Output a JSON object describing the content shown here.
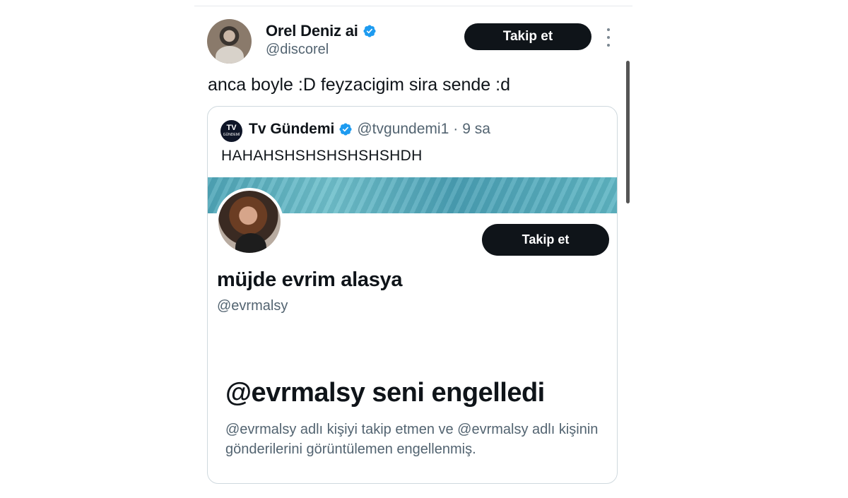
{
  "author": {
    "display_name": "Orel Deniz ai",
    "handle": "@discorel",
    "follow_label": "Takip et"
  },
  "tweet": {
    "text": "anca boyle :D feyzacigim sira sende :d"
  },
  "quoted": {
    "avatar_text": "TV",
    "avatar_subtext": "GÜNDEMİ",
    "display_name": "Tv Gündemi",
    "handle": "@tvgundemi1",
    "separator": "·",
    "time": "9 sa",
    "text": "HAHAHSHSHSHSHSHSHDH"
  },
  "profile": {
    "follow_label": "Takip et",
    "display_name": "müjde evrim alasya",
    "handle": "@evrmalsy",
    "blocked_title": "@evrmalsy seni engelledi",
    "blocked_description": "@evrmalsy adlı kişiyi takip etmen ve @evrmalsy adlı kişinin gönderilerini görüntülemen engellenmiş."
  },
  "colors": {
    "verified_blue": "#1d9bf0",
    "button_bg": "#0f1419",
    "secondary_text": "#536471"
  },
  "icons": [
    "verified-badge-icon",
    "more-options-icon"
  ]
}
